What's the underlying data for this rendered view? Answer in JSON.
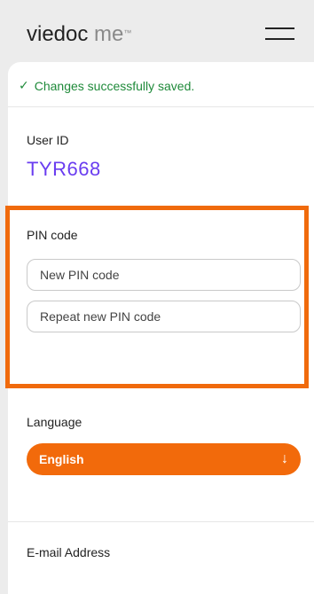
{
  "header": {
    "brand_main": "viedoc",
    "brand_sub": "me",
    "brand_tm": "™"
  },
  "toast": {
    "icon": "✓",
    "text": "Changes successfully saved."
  },
  "user": {
    "label": "User ID",
    "value": "TYR668"
  },
  "pin": {
    "label": "PIN code",
    "new_placeholder": "New PIN code",
    "repeat_placeholder": "Repeat new PIN code"
  },
  "language": {
    "label": "Language",
    "selected": "English",
    "arrow": "↓"
  },
  "email": {
    "label": "E-mail Address"
  },
  "colors": {
    "accent": "#f26a0b",
    "success": "#1f8a3a",
    "id_purple": "#6a3df0"
  }
}
